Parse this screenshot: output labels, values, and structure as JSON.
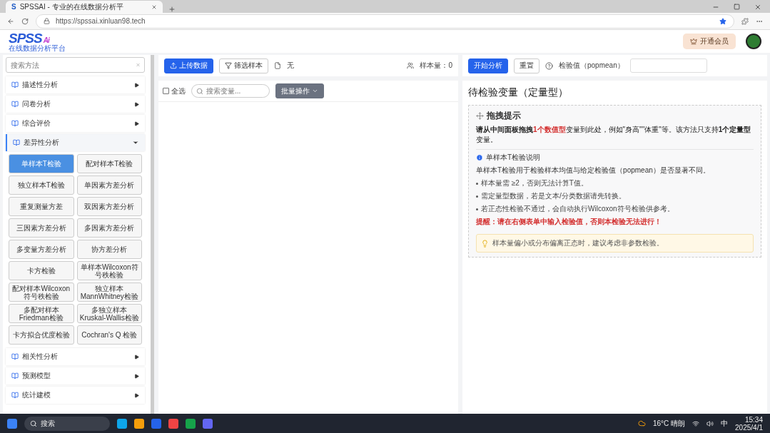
{
  "browser": {
    "favicon": "S",
    "tab_title": "SPSSAI - 专业的在线数据分析平",
    "url": "https://spssai.xinluan98.tech"
  },
  "header": {
    "logo": "SPSS",
    "logo_suffix": "Ai",
    "logo_subtitle": "在线数据分析平台",
    "vip_button": "开通会员"
  },
  "sidebar": {
    "search": {
      "placeholder": "搜索方法"
    },
    "categories": [
      {
        "label": "描述性分析",
        "expanded": false
      },
      {
        "label": "问卷分析",
        "expanded": false
      },
      {
        "label": "综合评价",
        "expanded": false
      },
      {
        "label": "差异性分析",
        "expanded": true,
        "methods": [
          {
            "label": "单样本T检验",
            "selected": true
          },
          {
            "label": "配对样本T检验",
            "selected": false
          },
          {
            "label": "独立样本T检验",
            "selected": false
          },
          {
            "label": "单因素方差分析",
            "selected": false
          },
          {
            "label": "重复测量方差",
            "selected": false
          },
          {
            "label": "双因素方差分析",
            "selected": false
          },
          {
            "label": "三因素方差分析",
            "selected": false
          },
          {
            "label": "多因素方差分析",
            "selected": false
          },
          {
            "label": "多变量方差分析",
            "selected": false
          },
          {
            "label": "协方差分析",
            "selected": false
          },
          {
            "label": "卡方检验",
            "selected": false
          },
          {
            "label": "单样本Wilcoxon符号秩检验",
            "selected": false
          },
          {
            "label": "配对样本Wilcoxon符号秩检验",
            "selected": false
          },
          {
            "label": "独立样本MannWhitney检验",
            "selected": false
          },
          {
            "label": "多配对样本Friedman检验",
            "selected": false
          },
          {
            "label": "多独立样本Kruskal-Wallis检验",
            "selected": false
          },
          {
            "label": "卡方拟合优度检验",
            "selected": false
          },
          {
            "label": "Cochran's Q 检验",
            "selected": false
          }
        ]
      },
      {
        "label": "相关性分析",
        "expanded": false
      },
      {
        "label": "预测模型",
        "expanded": false
      },
      {
        "label": "统计建模",
        "expanded": false
      }
    ]
  },
  "data_panel": {
    "upload_button": "上传数据",
    "filter_button": "筛选样本",
    "file_name": "无",
    "sample_count": "样本量：0",
    "select_all": {
      "label": "全选",
      "checked": false
    },
    "variable_search": {
      "placeholder": "搜索变量..."
    },
    "batch_button": "批量操作"
  },
  "analysis_panel": {
    "start_button": "开始分析",
    "reset_button": "重置",
    "test_value_label": "检验值（popmean）",
    "title": "待检验变量（定量型）",
    "hint": {
      "title": "拖拽提示",
      "parts": [
        {
          "text": "请从中间面板拖拽",
          "kind": "bold"
        },
        {
          "text": "1个数值型",
          "kind": "red"
        },
        {
          "text": "变量到此处，例如\"身高\"\"体重\"等。该方法只支持",
          "kind": "normal"
        },
        {
          "text": "1个定量型",
          "kind": "bold"
        },
        {
          "text": "变量。",
          "kind": "normal"
        }
      ],
      "info_title": "单样本T检验说明",
      "info_text": "单样本T检验用于检验样本均值与给定检验值（popmean）是否显著不同。",
      "bullets": [
        "样本量需 ≥2，否则无法计算T值。",
        "需定量型数据，若是文本/分类数据请先转换。",
        "若正态性检验不通过，会自动执行Wilcoxon符号检验供参考。"
      ],
      "warning": "提醒：请在右侧表单中输入检验值，否则本检验无法进行！",
      "tip": "样本量偏小或分布偏离正态时，建议考虑非参数检验。"
    }
  },
  "taskbar": {
    "search": "搜索",
    "weather": "16°C 晴朗",
    "ime": "中",
    "time": "15:34",
    "date": "2025/4/1"
  }
}
